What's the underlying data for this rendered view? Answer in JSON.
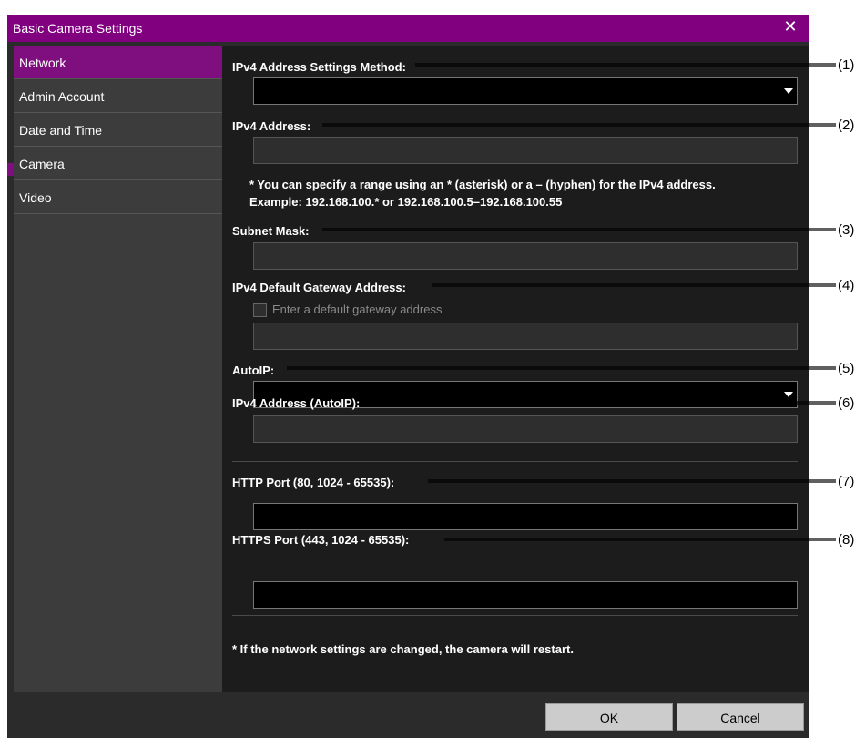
{
  "dialog": {
    "title": "Basic Camera Settings",
    "close_glyph": "✕"
  },
  "sidebar": {
    "items": [
      {
        "label": "Network"
      },
      {
        "label": "Admin Account"
      },
      {
        "label": "Date and Time"
      },
      {
        "label": "Camera"
      },
      {
        "label": "Video"
      }
    ]
  },
  "form": {
    "ipv4_method_label": "IPv4 Address Settings Method:",
    "ipv4_address_label": "IPv4 Address:",
    "ipv4_note_line1": "* You can specify a range using an * (asterisk) or a – (hyphen) for the IPv4 address.",
    "ipv4_note_line2": "Example: 192.168.100.* or 192.168.100.5–192.168.100.55",
    "subnet_label": "Subnet Mask:",
    "gateway_label": "IPv4 Default Gateway Address:",
    "gateway_checkbox_label": "Enter a default gateway address",
    "autoip_label": "AutoIP:",
    "autoip_address_label": "IPv4 Address (AutoIP):",
    "http_port_label": "HTTP Port (80, 1024 - 65535):",
    "https_port_label": "HTTPS Port (443, 1024 - 65535):",
    "restart_note": "* If the network settings are changed, the camera will restart."
  },
  "buttons": {
    "ok": "OK",
    "cancel": "Cancel"
  },
  "callouts": [
    "(1)",
    "(2)",
    "(3)",
    "(4)",
    "(5)",
    "(6)",
    "(7)",
    "(8)"
  ],
  "colors": {
    "accent": "#800080",
    "panel": "#2b2b2b",
    "content": "#1c1c1c"
  }
}
